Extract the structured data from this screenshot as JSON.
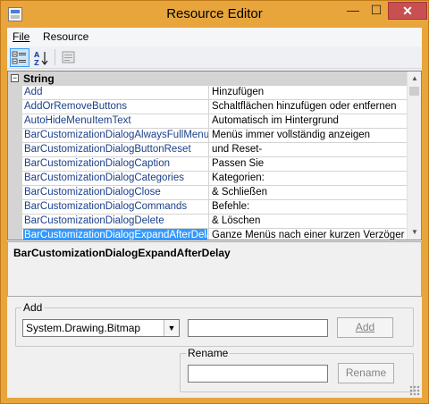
{
  "window": {
    "title": "Resource Editor",
    "close_glyph": "✕",
    "min_glyph": "—",
    "max_glyph": "☐"
  },
  "menu": [
    {
      "label": "File"
    },
    {
      "label": "Resource"
    }
  ],
  "grid": {
    "category": "String",
    "rows": [
      {
        "name": "Add",
        "value": "Hinzufügen"
      },
      {
        "name": "AddOrRemoveButtons",
        "value": "Schaltflächen hinzufügen oder entfernen"
      },
      {
        "name": "AutoHideMenuItemText",
        "value": "Automatisch im Hintergrund"
      },
      {
        "name": "BarCustomizationDialogAlwaysFullMenu",
        "value": "Menüs immer vollständig anzeigen"
      },
      {
        "name": "BarCustomizationDialogButtonReset",
        "value": "und Reset-"
      },
      {
        "name": "BarCustomizationDialogCaption",
        "value": "Passen Sie"
      },
      {
        "name": "BarCustomizationDialogCategories",
        "value": "Kategorien:"
      },
      {
        "name": "BarCustomizationDialogClose",
        "value": "& Schließen"
      },
      {
        "name": "BarCustomizationDialogCommands",
        "value": "Befehle:"
      },
      {
        "name": "BarCustomizationDialogDelete",
        "value": "& Löschen"
      },
      {
        "name": "BarCustomizationDialogExpandAfterDela",
        "value": "Ganze Menüs nach einer kurzen Verzögerung"
      }
    ]
  },
  "description": {
    "title": "BarCustomizationDialogExpandAfterDelay"
  },
  "add_group": {
    "label": "Add",
    "type_value": "System.Drawing.Bitmap",
    "name_value": "",
    "button": "Add"
  },
  "rename_group": {
    "label": "Rename",
    "name_value": "",
    "button": "Rename"
  },
  "colors": {
    "titlebar": "#e8a53c",
    "selection": "#3399ff",
    "close": "#c75050"
  }
}
